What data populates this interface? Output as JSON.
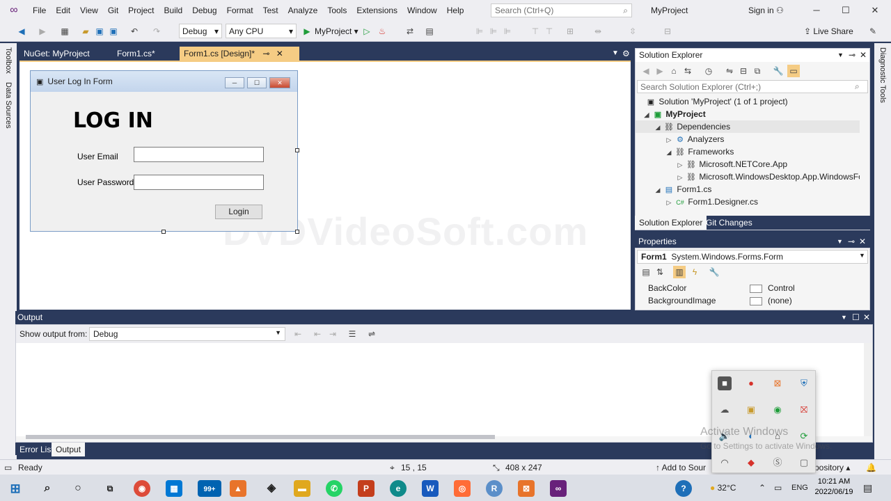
{
  "menubar": {
    "items": [
      "File",
      "Edit",
      "View",
      "Git",
      "Project",
      "Build",
      "Debug",
      "Format",
      "Test",
      "Analyze",
      "Tools",
      "Extensions",
      "Window",
      "Help"
    ],
    "search_placeholder": "Search (Ctrl+Q)",
    "project_name": "MyProject",
    "sign_in": "Sign in"
  },
  "toolbar": {
    "config": "Debug",
    "platform": "Any CPU",
    "run_target": "MyProject",
    "live_share": "Live Share"
  },
  "left_rail": {
    "toolbox": "Toolbox",
    "data_sources": "Data Sources"
  },
  "right_rail": {
    "diagnostic_tools": "Diagnostic Tools"
  },
  "doc_tabs": [
    "NuGet: MyProject",
    "Form1.cs*",
    "Form1.cs [Design]*"
  ],
  "form": {
    "title": "User Log In Form",
    "heading": "LOG IN",
    "email_label": "User Email",
    "password_label": "User Password",
    "login_button": "Login"
  },
  "solution_explorer": {
    "title": "Solution Explorer",
    "search_placeholder": "Search Solution Explorer (Ctrl+;)",
    "tree": [
      {
        "label": "Solution 'MyProject' (1 of 1 project)",
        "depth": 0,
        "bold": false
      },
      {
        "label": "MyProject",
        "depth": 1,
        "bold": true
      },
      {
        "label": "Dependencies",
        "depth": 2,
        "bold": false
      },
      {
        "label": "Analyzers",
        "depth": 3,
        "bold": false
      },
      {
        "label": "Frameworks",
        "depth": 3,
        "bold": false
      },
      {
        "label": "Microsoft.NETCore.App",
        "depth": 4,
        "bold": false
      },
      {
        "label": "Microsoft.WindowsDesktop.App.WindowsFo",
        "depth": 4,
        "bold": false
      },
      {
        "label": "Form1.cs",
        "depth": 2,
        "bold": false
      },
      {
        "label": "Form1.Designer.cs",
        "depth": 3,
        "bold": false
      }
    ],
    "tabs": [
      "Solution Explorer",
      "Git Changes"
    ]
  },
  "properties": {
    "title": "Properties",
    "object_name": "Form1",
    "object_type": "System.Windows.Forms.Form",
    "rows": [
      {
        "name": "BackColor",
        "value": "Control"
      },
      {
        "name": "BackgroundImage",
        "value": "(none)"
      }
    ]
  },
  "output": {
    "title": "Output",
    "show_from_label": "Show output from:",
    "source": "Debug"
  },
  "bottom_tabs": [
    "Error List",
    "Output"
  ],
  "statusbar": {
    "ready": "Ready",
    "position": "15 , 15",
    "size": "408 x 247",
    "add_to_source": "Add to Sour",
    "repository": "pository"
  },
  "watermark": {
    "activate": "Activate Windows",
    "activate_sub": "Go to Settings to activate Windows.",
    "dvd": "DVDVideoSoft.com"
  },
  "taskbar": {
    "badge": "99+",
    "temperature": "32°C",
    "language": "ENG",
    "time": "10:21 AM",
    "date": "2022/06/19"
  },
  "colors": {
    "chrome": "#eeeef2",
    "frame": "#2b3a5c",
    "active_tab": "#f5cc84",
    "vs_purple": "#68217a"
  }
}
